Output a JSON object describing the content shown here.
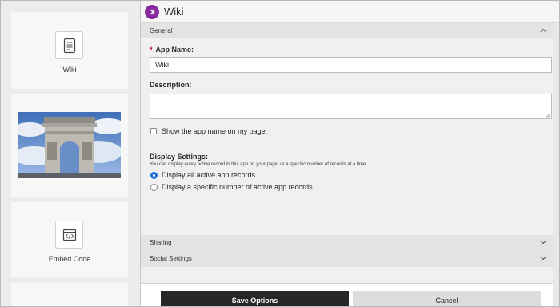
{
  "left_panel": {
    "cards": [
      {
        "label": "Wiki",
        "icon": "wiki-notebook-icon"
      },
      {
        "label": "",
        "icon": "arc-de-triomphe-photo"
      },
      {
        "label": "Embed Code",
        "icon": "embed-code-icon"
      }
    ]
  },
  "header": {
    "title": "Wiki",
    "app_icon": "chevron-right-circle-icon",
    "accent_color": "#8a2c9f"
  },
  "sections": {
    "general": "General",
    "sharing": "Sharing",
    "social": "Social Settings"
  },
  "form": {
    "required_mark": "*",
    "app_name_label": "App Name:",
    "app_name_value": "Wiki",
    "description_label": "Description:",
    "description_value": "",
    "show_name_label": "Show the app name on my page.",
    "show_name_checked": false,
    "display_settings_label": "Display Settings:",
    "display_settings_help": "You can display every active record in this app on your page, or a specific number of records at a time.",
    "radio_all_label": "Display all active app records",
    "radio_specific_label": "Display a specific number of active app records",
    "selected_option": "all"
  },
  "footer": {
    "save_label": "Save Options",
    "cancel_label": "Cancel"
  }
}
